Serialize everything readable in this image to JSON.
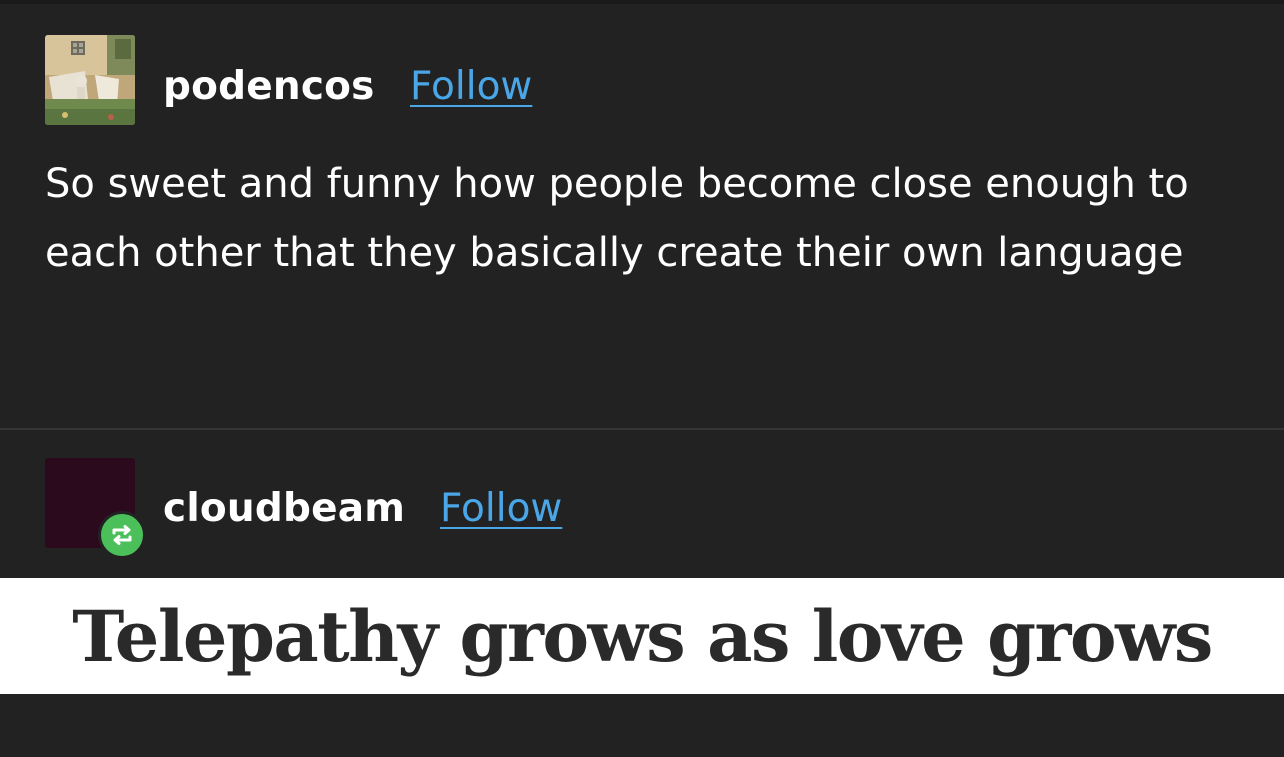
{
  "posts": [
    {
      "username": "podencos",
      "follow_label": "Follow",
      "body": "So sweet and funny how people become close enough to each other that they basically create their own language"
    },
    {
      "username": "cloudbeam",
      "follow_label": "Follow",
      "reblog_icon": "reblog-icon",
      "quote": "Telepathy grows as love grows"
    }
  ],
  "colors": {
    "background": "#222222",
    "follow_link": "#4aa6e6",
    "reblog_badge": "#4bc05a",
    "avatar_cloudbeam": "#2a0a1c"
  }
}
